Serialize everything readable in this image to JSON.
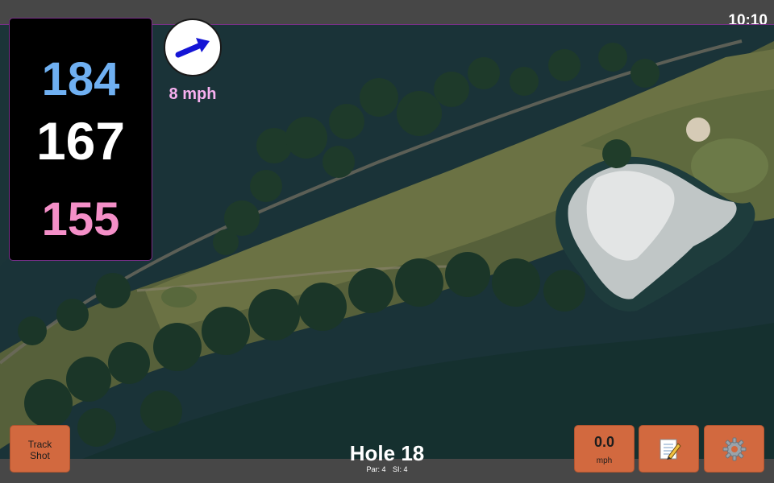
{
  "status_bar": {
    "clock": "10:10"
  },
  "distances": {
    "back": "184",
    "middle": "167",
    "front": "155"
  },
  "wind": {
    "speed": "8 mph",
    "arrow_icon": "wind-arrow-icon"
  },
  "hole": {
    "title": "Hole 18",
    "par": "Par: 4",
    "stroke_index": "SI: 4"
  },
  "buttons": {
    "track_shot_line1": "Track",
    "track_shot_line2": "Shot",
    "speed_value": "0.0",
    "speed_unit": "mph",
    "notes_icon": "notepad-icon",
    "settings_icon": "gear-icon"
  },
  "colors": {
    "back_distance": "#6fb0f2",
    "middle_distance": "#ffffff",
    "front_distance": "#f48fc8",
    "wind_speed": "#f7b0f0",
    "button_bg": "#d2693f",
    "panel_border": "#7a2f8a"
  }
}
